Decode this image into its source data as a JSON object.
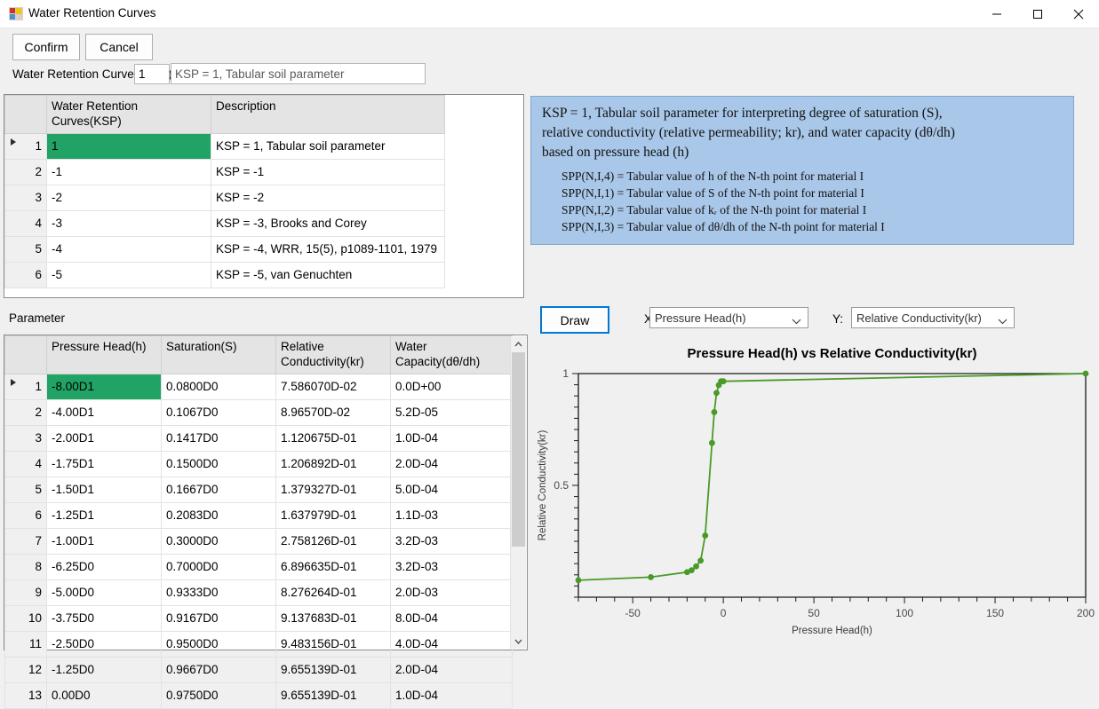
{
  "window": {
    "title": "Water Retention Curves",
    "icon": "form-designer-icon",
    "minimize": "minimize-icon",
    "maximize": "maximize-icon",
    "close": "close-icon"
  },
  "toolbar": {
    "confirm_label": "Confirm",
    "cancel_label": "Cancel",
    "ksp_label": "Water Retention Curves(KSP)",
    "ksp_value": "1",
    "ksp_description": "KSP = 1, Tabular soil parameter"
  },
  "ksp_grid": {
    "columns": [
      "",
      "Water Retention Curves(KSP)",
      "Description"
    ],
    "rows": [
      {
        "n": "1",
        "ksp": "1",
        "desc": "KSP = 1, Tabular soil parameter",
        "selected": true
      },
      {
        "n": "2",
        "ksp": "-1",
        "desc": "KSP = -1",
        "selected": false
      },
      {
        "n": "3",
        "ksp": "-2",
        "desc": "KSP = -2",
        "selected": false
      },
      {
        "n": "4",
        "ksp": "-3",
        "desc": "KSP = -3, Brooks and Corey",
        "selected": false
      },
      {
        "n": "5",
        "ksp": "-4",
        "desc": "KSP = -4, WRR, 15(5), p1089-1101, 1979",
        "selected": false
      },
      {
        "n": "6",
        "ksp": "-5",
        "desc": "KSP = -5, van Genuchten",
        "selected": false
      }
    ]
  },
  "description_panel": {
    "line1": "KSP = 1, Tabular soil parameter for interpreting degree of saturation (S),",
    "line2": "relative conductivity (relative permeability; kr), and water capacity (dθ/dh)",
    "line3": "based on pressure head (h)",
    "items": [
      "SPP(N,I,4) = Tabular value of h of the N-th point for material I",
      "SPP(N,I,1) = Tabular value of S of the N-th point for material I",
      "SPP(N,I,2) = Tabular value of kᵣ of the N-th point for material I",
      "SPP(N,I,3) = Tabular value of dθ/dh of the N-th point for material I"
    ]
  },
  "parameter_section": {
    "label": "Parameter",
    "columns": [
      "",
      "Pressure Head(h)",
      "Saturation(S)",
      "Relative Conductivity(kr)",
      "Water Capacity(dθ/dh)"
    ],
    "rows": [
      {
        "n": "1",
        "h": "-8.00D1",
        "s": "0.0800D0",
        "kr": "7.586070D-02",
        "wc": "0.0D+00",
        "selected": true
      },
      {
        "n": "2",
        "h": "-4.00D1",
        "s": "0.1067D0",
        "kr": "8.96570D-02",
        "wc": "5.2D-05",
        "selected": false
      },
      {
        "n": "3",
        "h": "-2.00D1",
        "s": "0.1417D0",
        "kr": "1.120675D-01",
        "wc": "1.0D-04",
        "selected": false
      },
      {
        "n": "4",
        "h": "-1.75D1",
        "s": "0.1500D0",
        "kr": "1.206892D-01",
        "wc": "2.0D-04",
        "selected": false
      },
      {
        "n": "5",
        "h": "-1.50D1",
        "s": "0.1667D0",
        "kr": "1.379327D-01",
        "wc": "5.0D-04",
        "selected": false
      },
      {
        "n": "6",
        "h": "-1.25D1",
        "s": "0.2083D0",
        "kr": "1.637979D-01",
        "wc": "1.1D-03",
        "selected": false
      },
      {
        "n": "7",
        "h": "-1.00D1",
        "s": "0.3000D0",
        "kr": "2.758126D-01",
        "wc": "3.2D-03",
        "selected": false
      },
      {
        "n": "8",
        "h": "-6.25D0",
        "s": "0.7000D0",
        "kr": "6.896635D-01",
        "wc": "3.2D-03",
        "selected": false
      },
      {
        "n": "9",
        "h": "-5.00D0",
        "s": "0.9333D0",
        "kr": "8.276264D-01",
        "wc": "2.0D-03",
        "selected": false
      },
      {
        "n": "10",
        "h": "-3.75D0",
        "s": "0.9167D0",
        "kr": "9.137683D-01",
        "wc": "8.0D-04",
        "selected": false
      },
      {
        "n": "11",
        "h": "-2.50D0",
        "s": "0.9500D0",
        "kr": "9.483156D-01",
        "wc": "4.0D-04",
        "selected": false
      },
      {
        "n": "12",
        "h": "-1.25D0",
        "s": "0.9667D0",
        "kr": "9.655139D-01",
        "wc": "2.0D-04",
        "selected": false
      },
      {
        "n": "13",
        "h": "0.00D0",
        "s": "0.9750D0",
        "kr": "9.655139D-01",
        "wc": "1.0D-04",
        "selected": false
      }
    ]
  },
  "chart_controls": {
    "draw_label": "Draw",
    "x_label": "X:",
    "x_value": "Pressure Head(h)",
    "y_label": "Y:",
    "y_value": "Relative Conductivity(kr)"
  },
  "colors": {
    "selection_green": "#21a366",
    "series_green": "#4a9a28",
    "accent_blue": "#0078d7",
    "panel_blue": "#a9c7e8"
  },
  "chart_data": {
    "type": "line",
    "title": "Pressure Head(h) vs Relative Conductivity(kr)",
    "xlabel": "Pressure Head(h)",
    "ylabel": "Relative Conductivity(kr)",
    "xlim": [
      -80,
      200
    ],
    "ylim": [
      0.0,
      1.0
    ],
    "xticks": [
      -50,
      0,
      50,
      100,
      150,
      200
    ],
    "yticks": [
      0.5,
      1
    ],
    "grid": false,
    "legend": "none",
    "marker": "circle",
    "series": [
      {
        "name": "Relative Conductivity(kr)",
        "x": [
          -80,
          -40,
          -20,
          -17.5,
          -15,
          -12.5,
          -10,
          -6.25,
          -5.0,
          -3.75,
          -2.5,
          -1.25,
          0.0,
          200
        ],
        "y": [
          0.0758607,
          0.089657,
          0.1120675,
          0.1206892,
          0.1379327,
          0.1637979,
          0.2758126,
          0.6896635,
          0.8276264,
          0.9137683,
          0.9483156,
          0.9655139,
          0.9655139,
          1.0
        ]
      }
    ]
  }
}
